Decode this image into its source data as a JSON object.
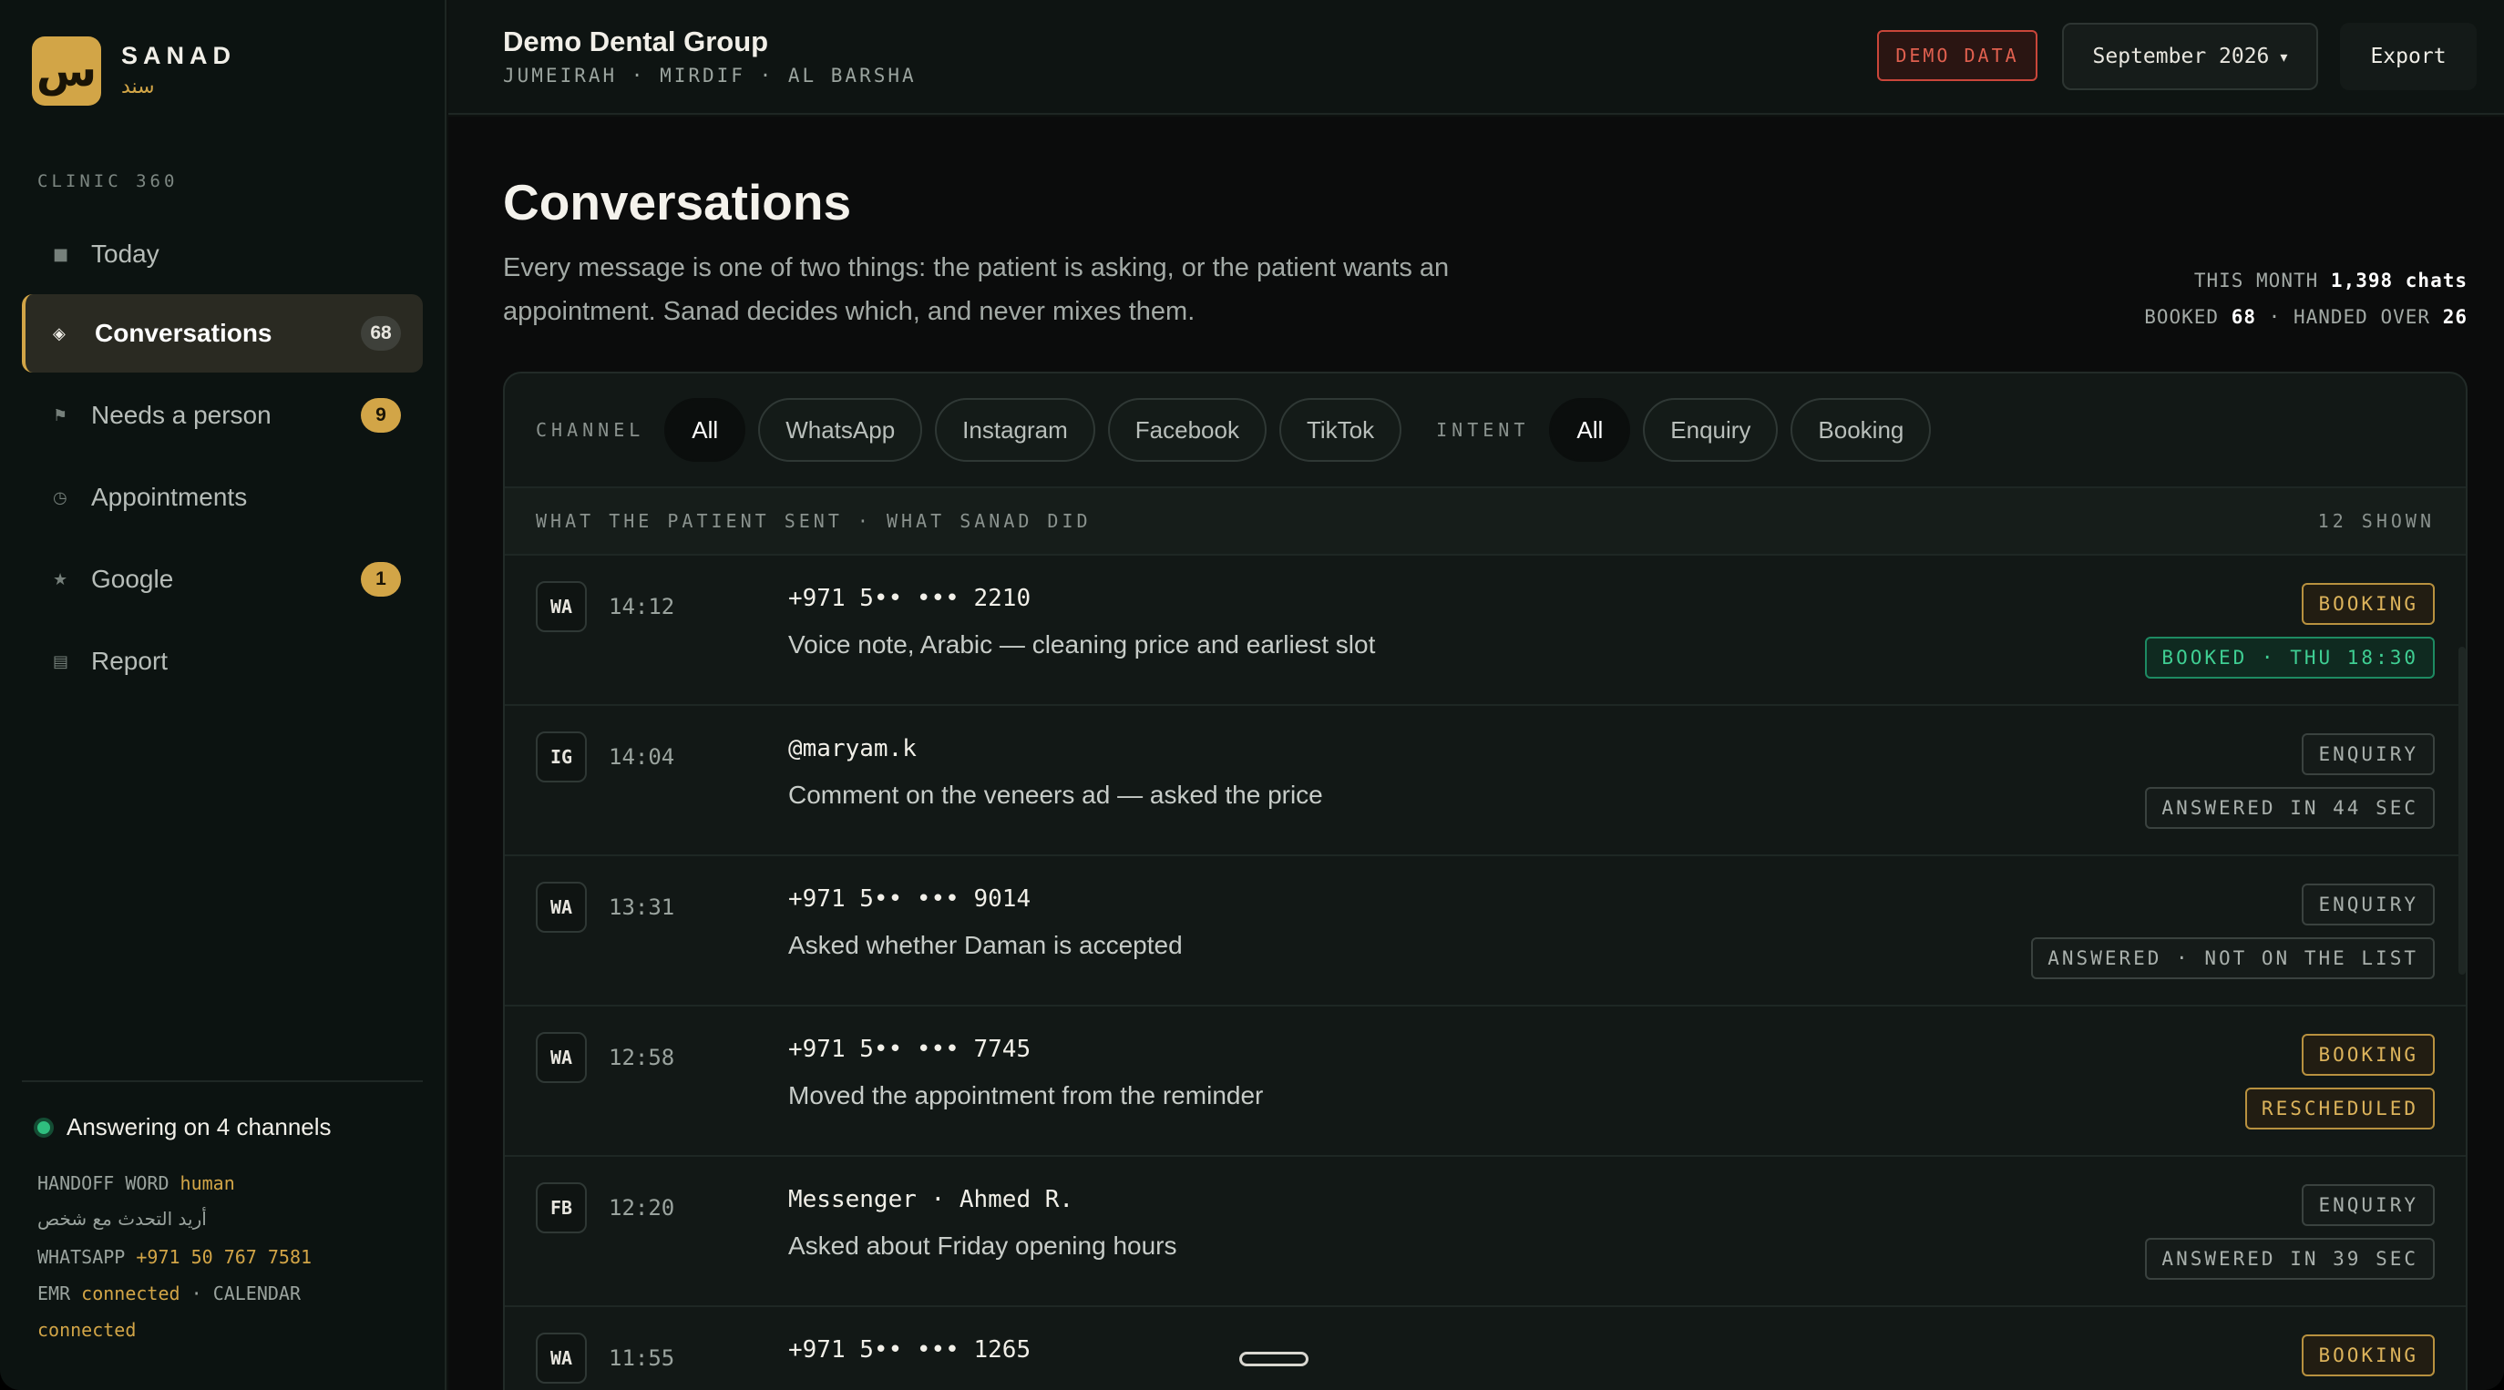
{
  "brand": {
    "logo_glyph": "س",
    "name": "SANAD",
    "name_ar": "سند",
    "accent": "#d2a547"
  },
  "sidebar": {
    "section": "CLINIC 360",
    "items": [
      {
        "icon": "square-icon",
        "glyph": "■",
        "label": "Today",
        "badge": ""
      },
      {
        "icon": "diamond-icon",
        "glyph": "◈",
        "label": "Conversations",
        "badge": "68",
        "active": true
      },
      {
        "icon": "flag-icon",
        "glyph": "⚑",
        "label": "Needs a person",
        "badge": "9"
      },
      {
        "icon": "clock-icon",
        "glyph": "◷",
        "label": "Appointments",
        "badge": ""
      },
      {
        "icon": "star-icon",
        "glyph": "★",
        "label": "Google",
        "badge": "1"
      },
      {
        "icon": "report-icon",
        "glyph": "▤",
        "label": "Report",
        "badge": ""
      }
    ],
    "status": {
      "text": "Answering on 4 channels",
      "handoff_label": "HANDOFF WORD",
      "handoff_word": "human",
      "handoff_ar": "أريد التحدث مع شخص",
      "whatsapp_label": "WHATSAPP",
      "whatsapp_number": "+971 50 767 7581",
      "emr_label": "EMR",
      "emr_status": "connected",
      "separator": "·",
      "calendar_label": "CALENDAR",
      "calendar_status": "connected"
    }
  },
  "header": {
    "org_name": "Demo Dental Group",
    "locations": "JUMEIRAH · MIRDIF · AL BARSHA",
    "demo_badge": "DEMO DATA",
    "month": "September 2026",
    "month_caret": "▾",
    "export_label": "Export"
  },
  "main": {
    "title": "Conversations",
    "description": "Every message is one of two things: the patient is asking, or the patient wants an appointment. Sanad decides which, and never mixes them.",
    "stats": {
      "month_label": "THIS MONTH",
      "month_value": "1,398 chats",
      "booked_label": "BOOKED",
      "booked_value": "68",
      "sep": "·",
      "handed_label": "HANDED OVER",
      "handed_value": "26"
    },
    "filters": {
      "channel_label": "CHANNEL",
      "channels": [
        "All",
        "WhatsApp",
        "Instagram",
        "Facebook",
        "TikTok"
      ],
      "intent_label": "INTENT",
      "intents": [
        "All",
        "Enquiry",
        "Booking"
      ]
    },
    "list_header": {
      "left": "WHAT THE PATIENT SENT · WHAT SANAD DID",
      "right": "12 SHOWN"
    },
    "rows": [
      {
        "channel": "WA",
        "time": "14:12",
        "contact": "+971 5•• ••• 2210",
        "summary": "Voice note, Arabic — cleaning price and earliest slot",
        "intent": "BOOKING",
        "intent_kind": "booking",
        "outcome": "BOOKED · THU 18:30",
        "outcome_kind": "booked"
      },
      {
        "channel": "IG",
        "time": "14:04",
        "contact": "@maryam.k",
        "summary": "Comment on the veneers ad — asked the price",
        "intent": "ENQUIRY",
        "intent_kind": "enquiry",
        "outcome": "ANSWERED IN 44 SEC",
        "outcome_kind": "neutral"
      },
      {
        "channel": "WA",
        "time": "13:31",
        "contact": "+971 5•• ••• 9014",
        "summary": "Asked whether Daman is accepted",
        "intent": "ENQUIRY",
        "intent_kind": "enquiry",
        "outcome": "ANSWERED · NOT ON THE LIST",
        "outcome_kind": "neutral"
      },
      {
        "channel": "WA",
        "time": "12:58",
        "contact": "+971 5•• ••• 7745",
        "summary": "Moved the appointment from the reminder",
        "intent": "BOOKING",
        "intent_kind": "booking",
        "outcome": "RESCHEDULED",
        "outcome_kind": "booking"
      },
      {
        "channel": "FB",
        "time": "12:20",
        "contact": "Messenger · Ahmed R.",
        "summary": "Asked about Friday opening hours",
        "intent": "ENQUIRY",
        "intent_kind": "enquiry",
        "outcome": "ANSWERED IN 39 SEC",
        "outcome_kind": "neutral"
      },
      {
        "channel": "WA",
        "time": "11:55",
        "contact": "+971 5•• ••• 1265",
        "summary": "",
        "intent": "BOOKING",
        "intent_kind": "booking",
        "outcome": "",
        "outcome_kind": "booked"
      }
    ]
  }
}
